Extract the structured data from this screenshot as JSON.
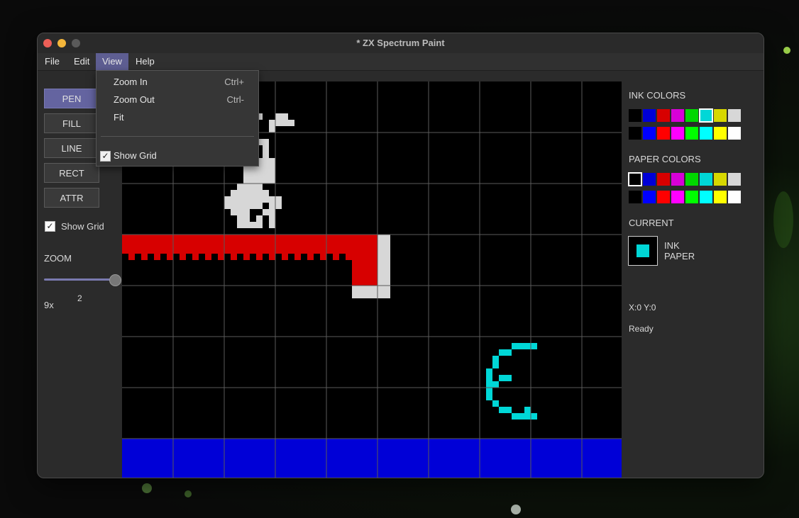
{
  "window": {
    "title": "* ZX Spectrum Paint"
  },
  "menubar": {
    "items": [
      "File",
      "Edit",
      "View",
      "Help"
    ],
    "active": "View"
  },
  "view_menu": {
    "items": [
      {
        "label": "Zoom In",
        "shortcut": "Ctrl+"
      },
      {
        "label": "Zoom Out",
        "shortcut": "Ctrl-"
      },
      {
        "label": "Fit",
        "shortcut": ""
      },
      {
        "label": "Show Grid",
        "shortcut": "",
        "checked": true
      }
    ]
  },
  "tools": {
    "buttons": [
      "PEN",
      "FILL",
      "LINE",
      "RECT",
      "ATTR"
    ],
    "active": "PEN",
    "show_grid_label": "Show Grid",
    "show_grid_checked": true,
    "zoom_label": "ZOOM",
    "zoom_value_label": "9x",
    "zoom_slider_value": "2"
  },
  "palette": {
    "ink_label": "INK COLORS",
    "paper_label": "PAPER COLORS",
    "normal": [
      "#000000",
      "#0000d7",
      "#d70000",
      "#d700d7",
      "#00d700",
      "#00d7d7",
      "#d7d700",
      "#d7d7d7"
    ],
    "bright": [
      "#000000",
      "#0000ff",
      "#ff0000",
      "#ff00ff",
      "#00ff00",
      "#00ffff",
      "#ffff00",
      "#ffffff"
    ],
    "ink_selected_index": 5,
    "paper_selected_index": 0
  },
  "current": {
    "label": "CURRENT",
    "ink_label": "INK",
    "paper_label": "PAPER",
    "ink_color": "#00d7d7",
    "paper_color": "#000000"
  },
  "status": {
    "coords": "X:0 Y:0",
    "text": "Ready"
  },
  "colors": {
    "accent": "#6464a0",
    "ink_grey": "#d7d7d7",
    "ink_red": "#d70000",
    "ink_cyan": "#00d7d7",
    "paper_blue": "#0000d7"
  }
}
